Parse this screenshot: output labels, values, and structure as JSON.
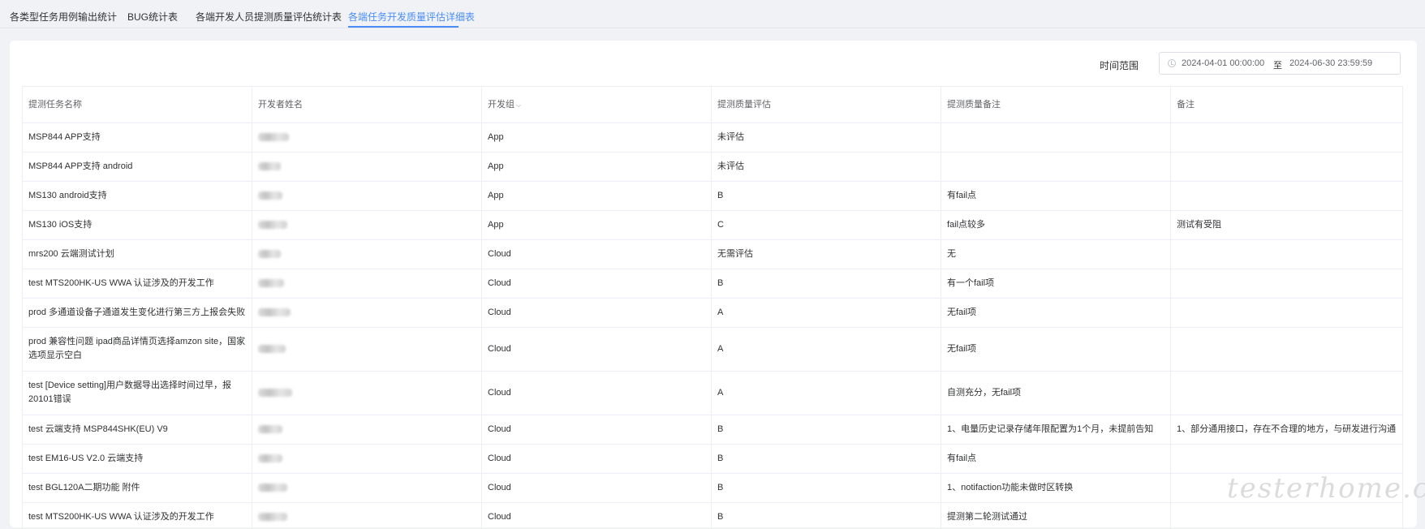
{
  "tabs": [
    {
      "label": "各类型任务用例输出统计",
      "active": false
    },
    {
      "label": "BUG统计表",
      "active": false
    },
    {
      "label": "各端开发人员提测质量评估统计表",
      "active": false
    },
    {
      "label": "各端任务开发质量评估详细表",
      "active": true
    }
  ],
  "filter": {
    "label": "时间范围",
    "start": "2024-04-01 00:00:00",
    "separator": "至",
    "end": "2024-06-30 23:59:59"
  },
  "table": {
    "columns": [
      "提测任务名称",
      "开发者姓名",
      "开发组",
      "提测质量评估",
      "提测质量备注",
      "备注"
    ],
    "rows": [
      {
        "task": "MSP844 APP支持",
        "group": "App",
        "quality": "未评估",
        "quality_note": "",
        "note": ""
      },
      {
        "task": "MSP844 APP支持 android",
        "group": "App",
        "quality": "未评估",
        "quality_note": "",
        "note": ""
      },
      {
        "task": "MS130 android支持",
        "group": "App",
        "quality": "B",
        "quality_note": "有fail点",
        "note": ""
      },
      {
        "task": "MS130 iOS支持",
        "group": "App",
        "quality": "C",
        "quality_note": "fail点较多",
        "note": "测试有受阻"
      },
      {
        "task": "mrs200 云端测试计划",
        "group": "Cloud",
        "quality": "无需评估",
        "quality_note": "无",
        "note": ""
      },
      {
        "task": "test MTS200HK-US WWA 认证涉及的开发工作",
        "group": "Cloud",
        "quality": "B",
        "quality_note": "有一个fail项",
        "note": ""
      },
      {
        "task": "prod 多通道设备子通道发生变化进行第三方上报会失败",
        "group": "Cloud",
        "quality": "A",
        "quality_note": "无fail项",
        "note": ""
      },
      {
        "task": "prod 兼容性问题 ipad商品详情页选择amzon site，国家选项显示空白",
        "group": "Cloud",
        "quality": "A",
        "quality_note": "无fail项",
        "note": ""
      },
      {
        "task": "test [Device setting]用户数据导出选择时间过早，报20101错误",
        "group": "Cloud",
        "quality": "A",
        "quality_note": "自测充分，无fail项",
        "note": ""
      },
      {
        "task": "test 云端支持 MSP844SHK(EU) V9",
        "group": "Cloud",
        "quality": "B",
        "quality_note": "1、电量历史记录存储年限配置为1个月，未提前告知",
        "note": "1、部分通用接口，存在不合理的地方，与研发进行沟通"
      },
      {
        "task": "test EM16-US V2.0 云端支持",
        "group": "Cloud",
        "quality": "B",
        "quality_note": "有fail点",
        "note": ""
      },
      {
        "task": "test BGL120A二期功能 附件",
        "group": "Cloud",
        "quality": "B",
        "quality_note": "1、notifaction功能未做时区转换",
        "note": ""
      },
      {
        "task": "test MTS200HK-US WWA 认证涉及的开发工作",
        "group": "Cloud",
        "quality": "B",
        "quality_note": "提测第二轮测试通过",
        "note": ""
      }
    ]
  },
  "watermark": "testerhome.com"
}
